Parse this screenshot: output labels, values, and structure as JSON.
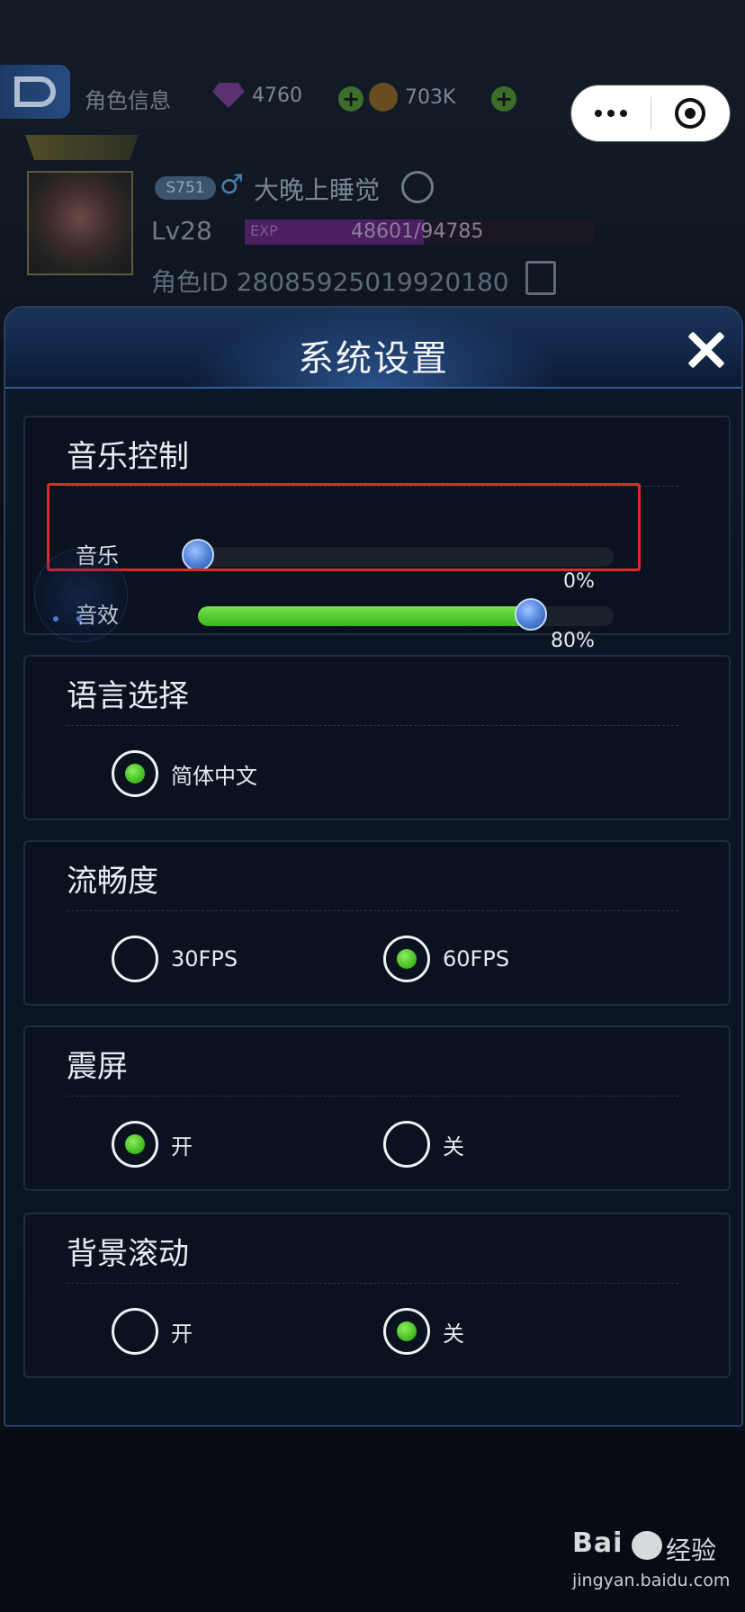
{
  "header": {
    "title": "角色信息",
    "diamonds": "4760",
    "gold": "703K"
  },
  "profile": {
    "server": "S751",
    "gender_symbol": "♂",
    "name": "大晚上睡觉",
    "level": "Lv28",
    "exp_label": "EXP",
    "exp_current": "48601",
    "exp_total": "94785",
    "exp_text": "48601/94785",
    "exp_fraction": 0.513,
    "role_id_label": "角色ID",
    "role_id": "28085925019920180"
  },
  "settings": {
    "title": "系统设置",
    "music_section": {
      "title": "音乐控制",
      "music": {
        "label": "音乐",
        "value": 0,
        "value_text": "0%"
      },
      "sfx": {
        "label": "音效",
        "value": 80,
        "value_text": "80%"
      }
    },
    "language_section": {
      "title": "语言选择",
      "options": [
        {
          "label": "简体中文",
          "selected": true
        }
      ]
    },
    "fps_section": {
      "title": "流畅度",
      "options": [
        {
          "label": "30FPS",
          "selected": false
        },
        {
          "label": "60FPS",
          "selected": true
        }
      ]
    },
    "shake_section": {
      "title": "震屏",
      "options": [
        {
          "label": "开",
          "selected": true
        },
        {
          "label": "关",
          "selected": false
        }
      ]
    },
    "scroll_section": {
      "title": "背景滚动",
      "options": [
        {
          "label": "开",
          "selected": false
        },
        {
          "label": "关",
          "selected": true
        }
      ]
    }
  },
  "watermark": {
    "logo": "Bai",
    "logo_suffix": "经验",
    "url": "jingyan.baidu.com"
  },
  "colors": {
    "accent_green": "#3cb81e",
    "highlight_red": "#e3262a",
    "panel_blue": "#12274a"
  },
  "icons": [
    "back-icon",
    "gem-icon",
    "coin-icon",
    "plus-icon",
    "more-icon",
    "target-icon",
    "edit-icon",
    "copy-icon",
    "close-icon"
  ]
}
